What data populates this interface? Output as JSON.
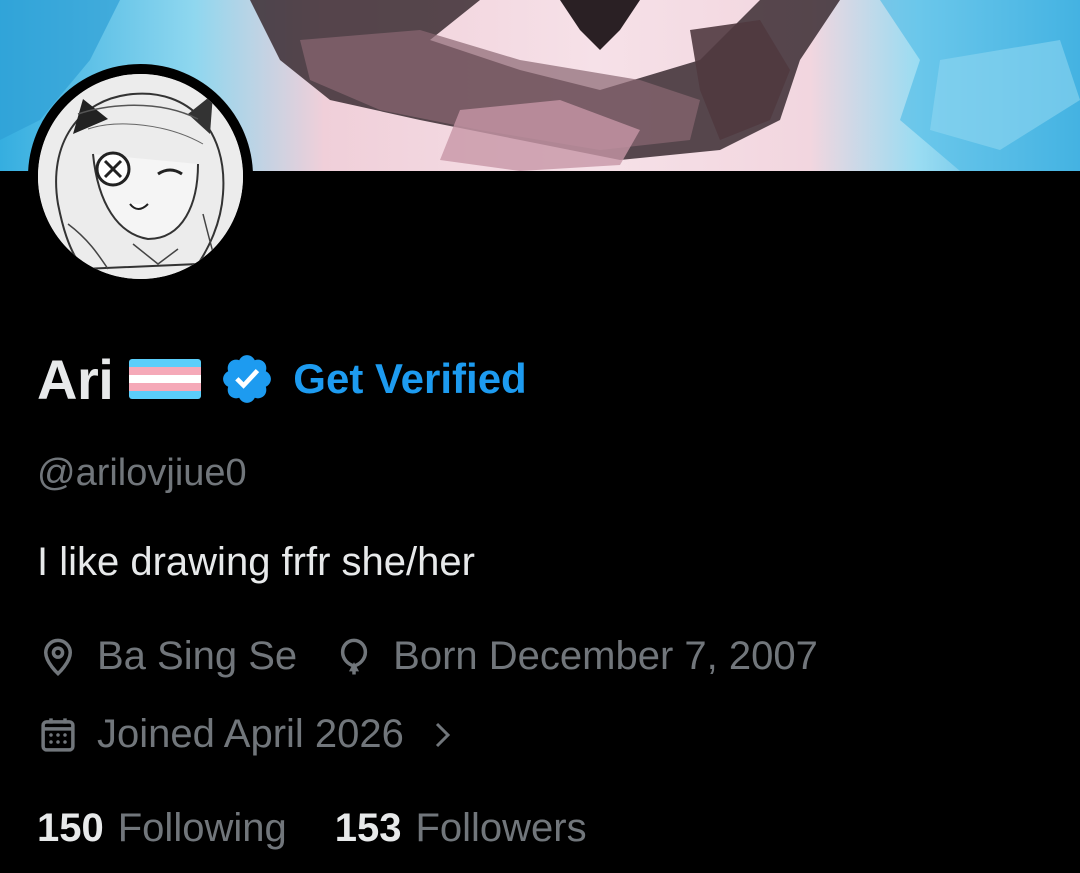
{
  "profile": {
    "display_name": "Ari",
    "get_verified_label": "Get Verified",
    "handle": "@arilovjiue0",
    "bio": "I like drawing frfr she/her",
    "location": "Ba Sing Se",
    "birthday": "Born December 7, 2007",
    "joined": "Joined April 2026"
  },
  "stats": {
    "following_count": "150",
    "following_label": "Following",
    "followers_count": "153",
    "followers_label": "Followers"
  },
  "icons": {
    "flag": "transgender-flag-icon",
    "verified": "verified-badge-icon",
    "location": "location-pin-icon",
    "birthday": "balloon-icon",
    "joined": "calendar-icon",
    "expand": "chevron-right-icon"
  },
  "colors": {
    "background": "#000000",
    "text_primary": "#e7e9ea",
    "text_secondary": "#71767b",
    "accent": "#1d9bf0"
  }
}
